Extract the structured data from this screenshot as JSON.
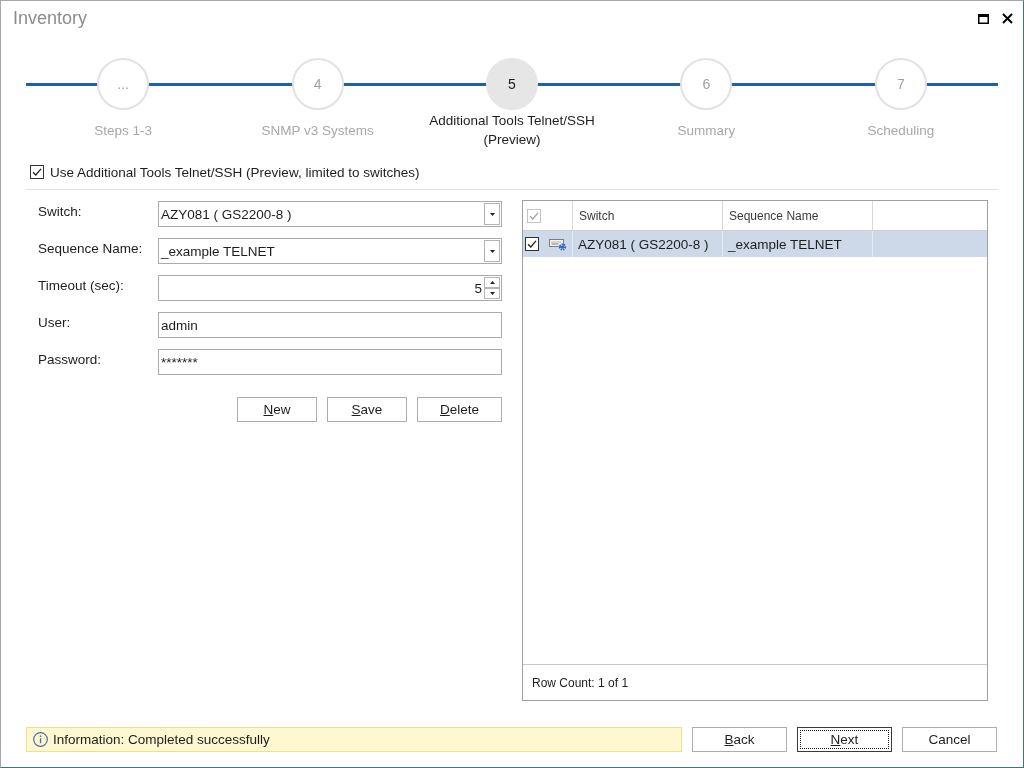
{
  "window": {
    "title": "Inventory"
  },
  "steps": [
    {
      "number": "...",
      "label": "Steps 1-3",
      "selected": false
    },
    {
      "number": "4",
      "label": "SNMP v3 Systems",
      "selected": false
    },
    {
      "number": "5",
      "label": "Additional Tools Telnet/SSH (Preview)",
      "selected": true
    },
    {
      "number": "6",
      "label": "Summary",
      "selected": false
    },
    {
      "number": "7",
      "label": "Scheduling",
      "selected": false
    }
  ],
  "enable_option": {
    "label": "Use Additional Tools Telnet/SSH (Preview, limited to switches)",
    "checked": true
  },
  "form": {
    "fields": [
      {
        "label": "Switch:",
        "kind": "combo",
        "value": "AZY081 ( GS2200-8 )"
      },
      {
        "label": "Sequence Name:",
        "kind": "combo",
        "value": "_example TELNET"
      },
      {
        "label": "Timeout (sec):",
        "kind": "spin",
        "value": "5"
      },
      {
        "label": "User:",
        "kind": "text",
        "value": "admin"
      },
      {
        "label": "Password:",
        "kind": "password",
        "value": "*******"
      }
    ],
    "buttons": [
      {
        "label": "New",
        "mnemonic": true
      },
      {
        "label": "Save",
        "mnemonic": true
      },
      {
        "label": "Delete",
        "mnemonic": true
      }
    ]
  },
  "grid": {
    "select_all": {
      "checked": true
    },
    "columns": [
      "Switch",
      "Sequence Name"
    ],
    "rows": [
      {
        "checked": true,
        "selected": true,
        "cells": [
          "AZY081 ( GS2200-8 )",
          "_example TELNET"
        ]
      }
    ],
    "footer": "Row Count: 1 of 1"
  },
  "status": {
    "text": "Information: Completed successfully"
  },
  "nav_buttons": [
    {
      "label": "Back",
      "mnemonic": true,
      "focused": false
    },
    {
      "label": "Next",
      "mnemonic": true,
      "focused": true
    },
    {
      "label": "Cancel",
      "mnemonic": false,
      "focused": false
    }
  ]
}
